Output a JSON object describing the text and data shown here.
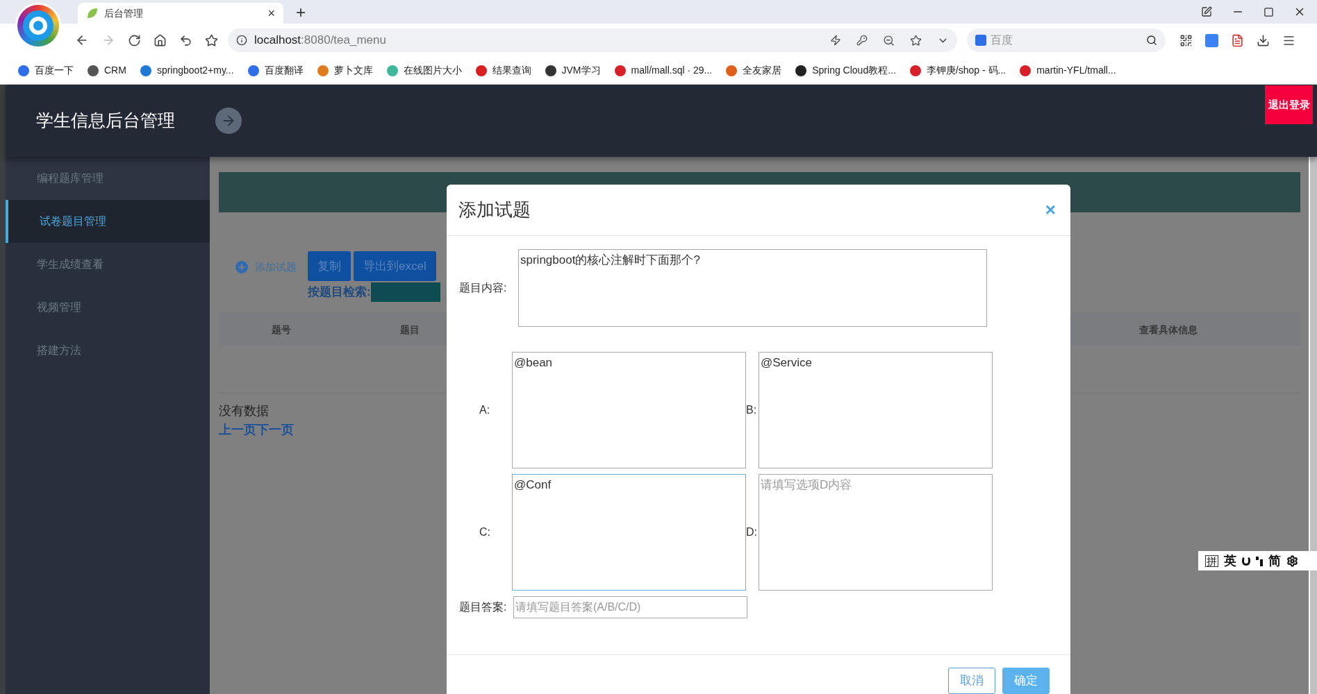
{
  "browser": {
    "tab": {
      "title": "后台管理",
      "close": "×"
    },
    "new_tab": "+",
    "address": {
      "host": "localhost",
      "path": ":8080/tea_menu"
    },
    "search": {
      "placeholder": "百度"
    },
    "bookmarks": [
      {
        "label": "百度一下",
        "color": "#2e6ee8"
      },
      {
        "label": "CRM",
        "color": "#555555"
      },
      {
        "label": "springboot2+my...",
        "color": "#1f7ad6"
      },
      {
        "label": "百度翻译",
        "color": "#2e6ee8"
      },
      {
        "label": "萝卜文库",
        "color": "#e07a1f"
      },
      {
        "label": "在线图片大小",
        "color": "#3fb89a"
      },
      {
        "label": "结果查询",
        "color": "#d81e1e"
      },
      {
        "label": "JVM学习",
        "color": "#333333"
      },
      {
        "label": "mall/mall.sql · 29...",
        "color": "#d8202a"
      },
      {
        "label": "全友家居",
        "color": "#e0601a"
      },
      {
        "label": "Spring Cloud教程...",
        "color": "#222222"
      },
      {
        "label": "李钾庚/shop - 码...",
        "color": "#d8202a"
      },
      {
        "label": "martin-YFL/tmall...",
        "color": "#d8202a"
      }
    ]
  },
  "header": {
    "title": "学生信息后台管理",
    "logout": "退出登录"
  },
  "sidebar": {
    "items": [
      {
        "label": "编程题库管理",
        "selected": false
      },
      {
        "label": "试卷题目管理",
        "selected": true
      },
      {
        "label": "学生成绩查看",
        "selected": false
      },
      {
        "label": "视频管理",
        "selected": false
      },
      {
        "label": "搭建方法",
        "selected": false
      }
    ]
  },
  "toolbar": {
    "add": "添加试题",
    "buttons": [
      "复制",
      "导出到excel"
    ],
    "search_label": "按题目检索:"
  },
  "table": {
    "columns": [
      "题号",
      "题目",
      "查看具体信息"
    ],
    "empty": "没有数据",
    "pager": "上一页下一页"
  },
  "modal": {
    "title": "添加试题",
    "close": "×",
    "content": {
      "label": "题目内容:",
      "value": "springboot的核心注解时下面那个?"
    },
    "options": [
      {
        "label": "A:",
        "value": "@bean",
        "focused": false
      },
      {
        "label": "B:",
        "value": "@Service",
        "focused": false
      },
      {
        "label": "C:",
        "value": "@Conf",
        "focused": true
      },
      {
        "label": "D:",
        "placeholder": "请填写选项D内容",
        "focused": false
      }
    ],
    "answer": {
      "label": "题目答案:",
      "placeholder": "请填写题目答案(A/B/C/D)"
    },
    "buttons": [
      {
        "label": "取消",
        "kind": "secondary"
      },
      {
        "label": "确定",
        "kind": "primary"
      }
    ]
  },
  "ime": [
    "拼",
    "英",
    "简"
  ]
}
